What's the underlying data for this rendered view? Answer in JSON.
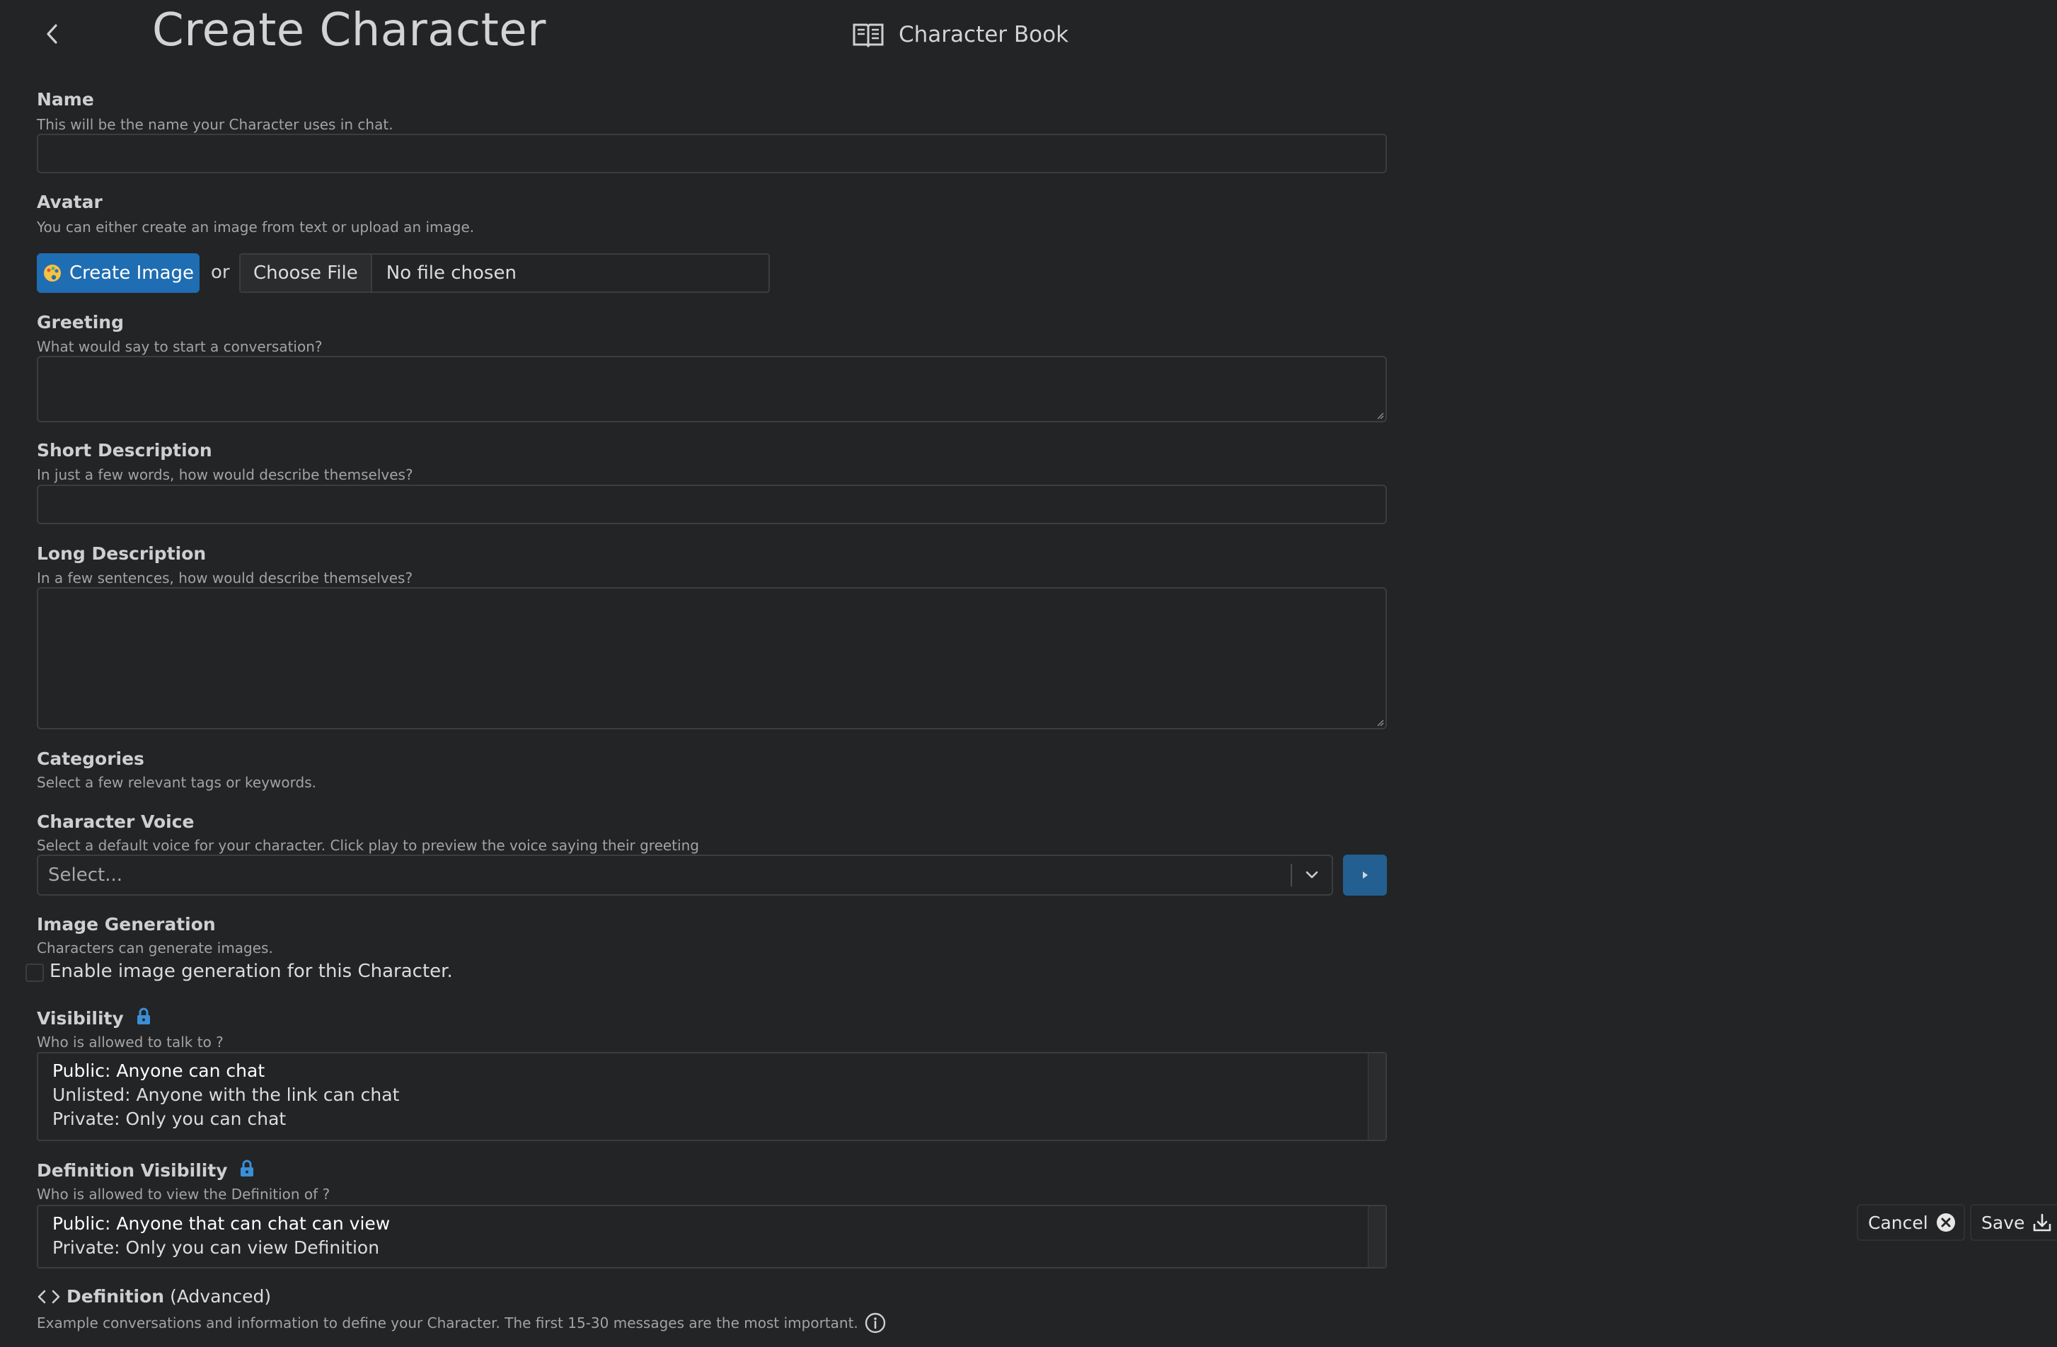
{
  "header": {
    "title": "Create Character",
    "book_label": "Character Book"
  },
  "form": {
    "name": {
      "label": "Name",
      "help": "This will be the name your Character uses in chat.",
      "value": ""
    },
    "avatar": {
      "label": "Avatar",
      "help": "You can either create an image from text or upload an image.",
      "create_label": "Create Image",
      "or_text": "or",
      "choose_file_label": "Choose File",
      "file_status": "No file chosen"
    },
    "greeting": {
      "label": "Greeting",
      "help": "What would say to start a conversation?",
      "value": ""
    },
    "short_description": {
      "label": "Short Description",
      "help": "In just a few words, how would describe themselves?",
      "value": ""
    },
    "long_description": {
      "label": "Long Description",
      "help": "In a few sentences, how would describe themselves?",
      "value": ""
    },
    "categories": {
      "label": "Categories",
      "help": "Select a few relevant tags or keywords."
    },
    "voice": {
      "label": "Character Voice",
      "help": "Select a default voice for your character. Click play to preview the voice saying their greeting",
      "placeholder": "Select..."
    },
    "image_generation": {
      "label": "Image Generation",
      "help": "Characters can generate images.",
      "checkbox_label": "Enable image generation for this Character.",
      "checked": false
    },
    "visibility": {
      "label": "Visibility",
      "help": "Who is allowed to talk to ?",
      "options": [
        "Public: Anyone can chat",
        "Unlisted: Anyone with the link can chat",
        "Private: Only you can chat"
      ],
      "selected": 0
    },
    "definition_visibility": {
      "label": "Definition Visibility",
      "help": "Who is allowed to view the Definition of ?",
      "options": [
        "Public: Anyone that can chat can view",
        "Private: Only you can view Definition"
      ],
      "selected": 0
    },
    "definition": {
      "label": "Definition",
      "suffix": "(Advanced)",
      "help": "Example conversations and information to define your Character. The first 15-30 messages are the most important."
    }
  },
  "actions": {
    "cancel_label": "Cancel",
    "save_label": "Save"
  },
  "colors": {
    "background": "#232425",
    "accent": "#1f6db3",
    "lock": "#3a8fd6"
  }
}
